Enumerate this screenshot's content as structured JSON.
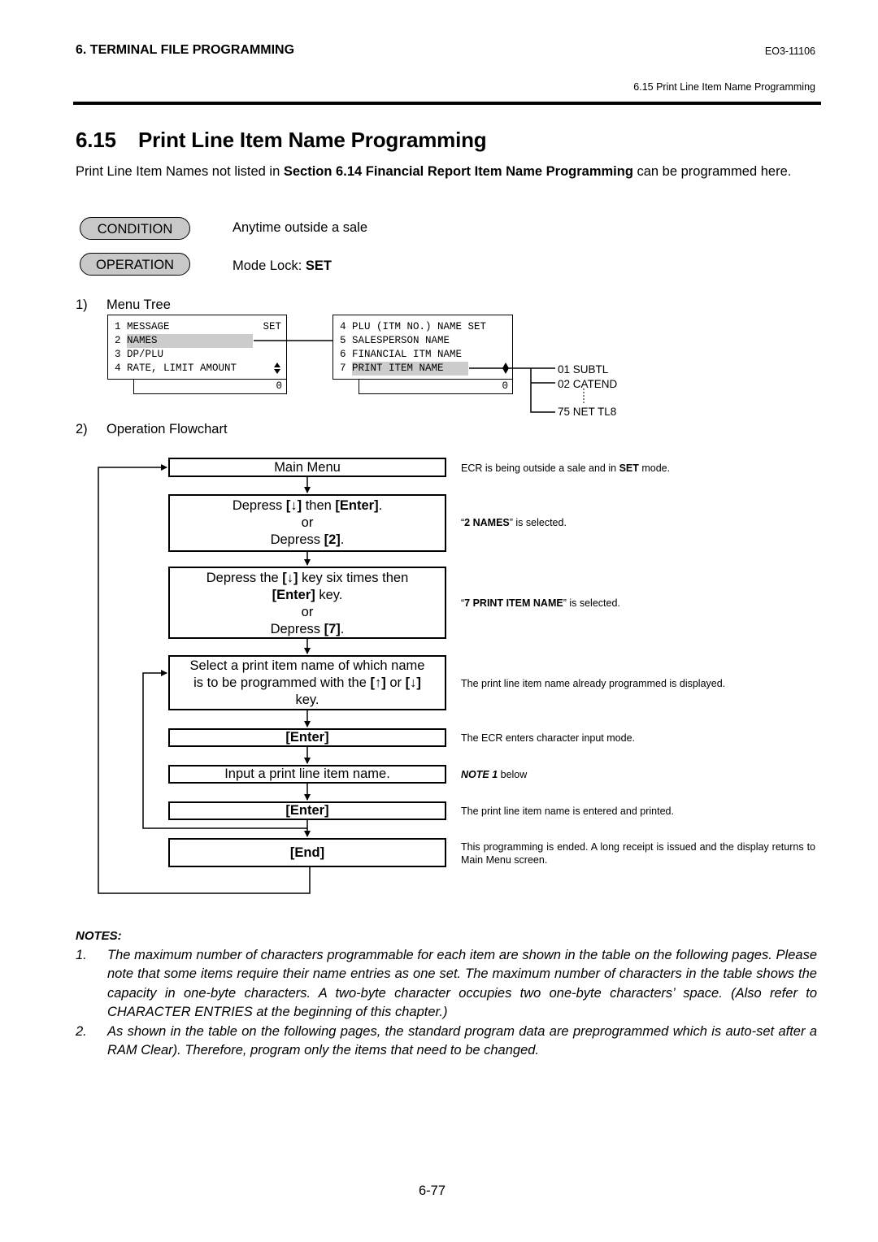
{
  "header": {
    "chapter": "6. TERMINAL FILE PROGRAMMING",
    "doc_id": "EO3-11106",
    "section_ref": "6.15 Print Line Item Name Programming"
  },
  "title": {
    "number": "6.15",
    "text": "Print Line Item Name Programming"
  },
  "intro": {
    "before": "Print Line Item Names not listed in ",
    "bold": "Section 6.14 Financial Report Item Name Programming",
    "after": " can be programmed here."
  },
  "condition": {
    "label": "CONDITION",
    "text": "Anytime outside a sale"
  },
  "operation": {
    "label": "OPERATION",
    "text_prefix": "Mode Lock: ",
    "text_bold": "SET"
  },
  "menu_tree": {
    "step_number": "1)",
    "label": "Menu Tree",
    "screen1": {
      "rows": [
        {
          "text": "1 MESSAGE",
          "right": "SET"
        },
        {
          "num": "2 ",
          "text": "NAMES",
          "highlighted": true
        },
        {
          "text": "3 DP/PLU"
        },
        {
          "text": "4 RATE, LIMIT AMOUNT",
          "scroll_icon": "up-down-arrows"
        }
      ],
      "footer": "0"
    },
    "screen2": {
      "rows": [
        {
          "text": "4 PLU (ITM NO.) NAME SET"
        },
        {
          "text": "5 SALESPERSON NAME"
        },
        {
          "text": "6 FINANCIAL ITM NAME"
        },
        {
          "num": "7 ",
          "text": "PRINT ITEM NAME",
          "highlighted": true,
          "scroll_icon": "diamond"
        }
      ],
      "footer": "0"
    },
    "items": [
      "01  SUBTL",
      "02  CATEND",
      "75 NET TL8"
    ]
  },
  "flowchart": {
    "step_number": "2)",
    "label": "Operation Flowchart",
    "boxes": [
      {
        "lines": [
          "Main Menu"
        ],
        "note": {
          "before": "ECR is being outside a sale and in ",
          "bold": "SET",
          "after": " mode."
        }
      },
      {
        "lines": [
          "Depress [↓] then [Enter].",
          "or",
          "Depress [2]."
        ],
        "note": {
          "before": "“",
          "bold": "2 NAMES",
          "after": "” is selected."
        }
      },
      {
        "lines": [
          "Depress the [↓] key six times then",
          "[Enter] key.",
          "or",
          "Depress [7]."
        ],
        "note": {
          "before": "“",
          "bold": "7 PRINT ITEM NAME",
          "after": "” is selected."
        }
      },
      {
        "lines": [
          "Select a print item name of which name",
          "is to be programmed with the [↑] or [↓]",
          "key."
        ],
        "note": {
          "before": "The print line item name already programmed is displayed.",
          "bold": "",
          "after": ""
        }
      },
      {
        "lines": [
          "[Enter]"
        ],
        "note": {
          "before": "The ECR enters character input mode.",
          "bold": "",
          "after": ""
        }
      },
      {
        "lines": [
          "Input a print line item name."
        ],
        "note": {
          "before": "",
          "bold": "NOTE 1",
          "after": " below"
        }
      },
      {
        "lines": [
          "[Enter]"
        ],
        "note": {
          "before": "The print line item name is entered and printed.",
          "bold": "",
          "after": ""
        }
      },
      {
        "lines": [
          "[End]"
        ],
        "note": {
          "before": "This programming is ended.  A long receipt is issued and the display returns to Main Menu screen.",
          "bold": "",
          "after": ""
        }
      }
    ]
  },
  "notes": {
    "title": "NOTES:",
    "items": [
      {
        "num": "1.",
        "text": "The maximum number of characters programmable for each item are shown in the table on the following pages. Please note that some items require their name entries as one set.  The maximum number of characters in the table shows the capacity in one-byte characters.  A two-byte character occupies two one-byte characters’ space. (Also refer to CHARACTER ENTRIES at the beginning of this chapter.)"
      },
      {
        "num": "2.",
        "text": "As shown in the table on the following pages, the standard program data are preprogrammed which is auto-set after a RAM Clear).  Therefore, program only the items that need to be changed."
      }
    ]
  },
  "page_number": "6-77"
}
